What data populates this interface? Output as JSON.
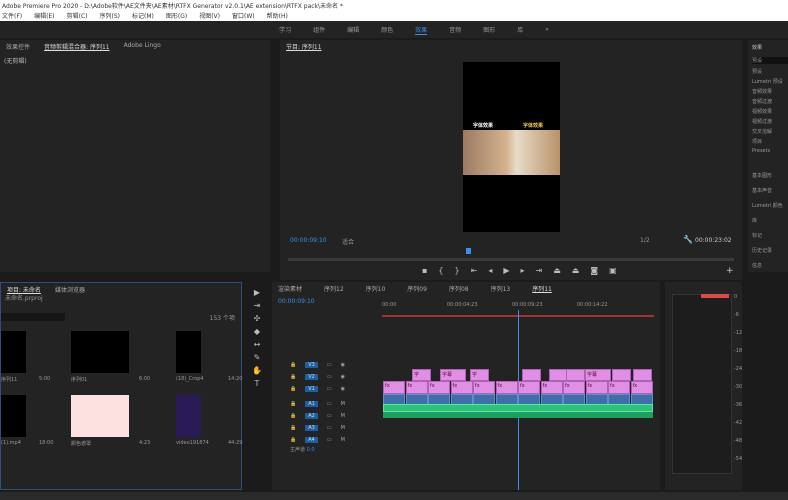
{
  "window": {
    "title": "Adobe Premiere Pro 2020 - D:\\Adobe软件\\AE文件夹\\AE素材\\RTFX Generator v2.0.1\\AE extension\\RTFX pack\\未命名 *"
  },
  "menu": [
    "文件(F)",
    "编辑(E)",
    "剪辑(C)",
    "序列(S)",
    "标记(M)",
    "图形(G)",
    "视图(V)",
    "窗口(W)",
    "帮助(H)"
  ],
  "workspaces": [
    {
      "label": "学习"
    },
    {
      "label": "组件"
    },
    {
      "label": "编辑"
    },
    {
      "label": "颜色"
    },
    {
      "label": "效果",
      "active": true
    },
    {
      "label": "音频"
    },
    {
      "label": "图形"
    },
    {
      "label": "库"
    },
    {
      "label": "»"
    }
  ],
  "source_panel": {
    "tabs": [
      "效果控件",
      "音频剪辑混合器: 序列11",
      "Adobe Lingo"
    ],
    "content": "(无剪辑)"
  },
  "program": {
    "title": "节目: 序列11",
    "timecode": "00:00:09:10",
    "fit": "适合",
    "quality": "1/2",
    "duration": "00:00:23:02",
    "overlay_left": "字体效果",
    "overlay_right": "字体效果",
    "playhead_fraction": 0.4,
    "accent": "#3d8ee6"
  },
  "project": {
    "tabs": [
      "项目: 未命名",
      "媒体浏览器"
    ],
    "path": "未命名.prproj",
    "count": "153 个项",
    "items": [
      {
        "name": "序列11",
        "dur": "5:00"
      },
      {
        "name": "序列01",
        "dur": "6:00"
      },
      {
        "name": "(18)_Crop4",
        "dur": "14:20"
      },
      {
        "name": "(1).mp4",
        "dur": "18:00"
      },
      {
        "name": "颜色遮罩",
        "dur": "4:23"
      },
      {
        "name": "video191874",
        "dur": "44:29"
      }
    ]
  },
  "tools": [
    "selection",
    "track-select",
    "ripple",
    "razor",
    "slip",
    "pen",
    "hand",
    "type"
  ],
  "timeline": {
    "tabs": [
      "渲染素材",
      "序列12",
      "序列10",
      "序列09",
      "序列08",
      "序列13",
      "序列11"
    ],
    "active_tab": "序列11",
    "timecode": "00:00:09:10",
    "ruler": [
      "00:00",
      "00:00:04:23",
      "00:00:09:23",
      "00:00:14:22"
    ],
    "tracks": [
      "V3",
      "V2",
      "V1",
      "A1",
      "A2",
      "A3",
      "A4"
    ],
    "master": "主声道",
    "master_val": "0.0",
    "v1_clips": [
      "fx",
      "fx",
      "fx",
      "fx",
      "fx",
      "fx",
      "fx",
      "fx",
      "fx",
      "fx",
      "fx",
      "fx"
    ],
    "v2_labels": [
      "字",
      "字幕",
      "字",
      "",
      "",
      "",
      "字幕",
      "",
      ""
    ]
  },
  "right": {
    "title": "效果",
    "search": "预设",
    "tree": [
      "预设",
      "Lumetri 预设",
      "音频效果",
      "音频过渡",
      "视频效果",
      "视频过渡",
      "交叉溶解",
      "项目",
      "Presets"
    ],
    "panels": [
      "基本图形",
      "基本声音",
      "Lumetri 颜色",
      "库",
      "标记",
      "历史记录",
      "信息"
    ]
  },
  "meter": {
    "scale": [
      "0",
      "-6",
      "-12",
      "-18",
      "-24",
      "-30",
      "-36",
      "-42",
      "-48",
      "-54"
    ],
    "peak_color": "#e04848"
  }
}
